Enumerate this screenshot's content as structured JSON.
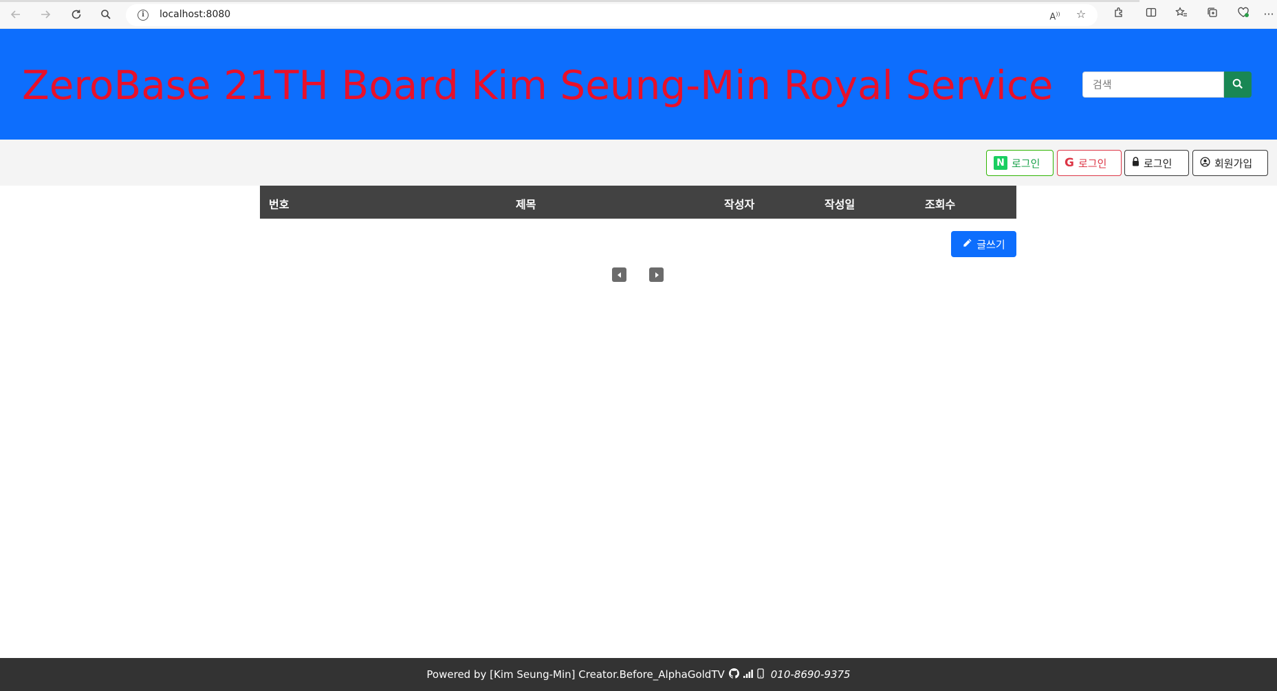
{
  "browser": {
    "url": "localhost:8080"
  },
  "header": {
    "title": "ZeroBase 21TH Board Kim Seung-Min Royal Service",
    "search_placeholder": "검색"
  },
  "auth": {
    "naver_label": "로그인",
    "google_label": "로그인",
    "login_label": "로그인",
    "join_label": "회원가입"
  },
  "board": {
    "columns": [
      "번호",
      "제목",
      "작성자",
      "작성일",
      "조회수"
    ],
    "rows": [],
    "write_label": "글쓰기"
  },
  "footer": {
    "credit": "Powered by [Kim Seung-Min] Creator.Before_AlphaGoldTV",
    "phone": "010-8690-9375"
  },
  "colors": {
    "header_bg": "#0d6efd",
    "title": "#e8102a",
    "search_button": "#198754",
    "table_head": "#424242",
    "footer_bg": "#333333",
    "naver_green": "#19ce60",
    "google_red": "#dc3545"
  }
}
